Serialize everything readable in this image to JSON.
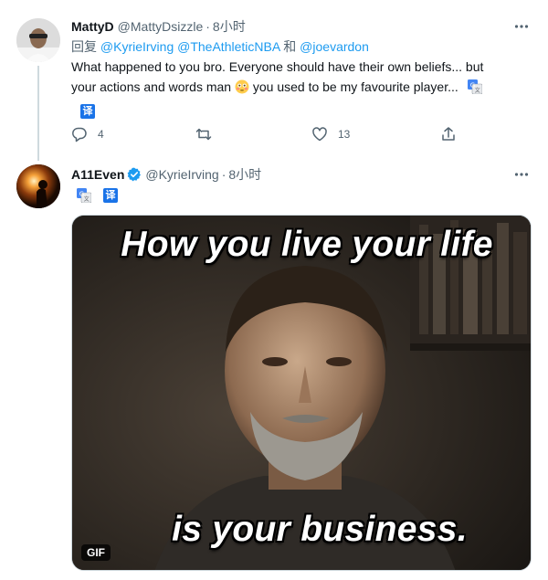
{
  "reply_tweet": {
    "display_name": "MattyD",
    "handle": "@MattyDsizzle",
    "separator": "·",
    "time": "8小时",
    "reply_prefix": "回复",
    "mentions": [
      "@KyrieIrving",
      "@TheAthleticNBA"
    ],
    "mention_joiner": "和",
    "last_mention": "@joevardon",
    "text_line1": "What happened to you bro. Everyone should have their own beliefs... but",
    "text_line2a": "your actions and words man",
    "emoji": "flushed-face",
    "text_line2b": "you used to be my favourite player...",
    "translate_badge": "译",
    "reply_count": "4",
    "retweet_count": "",
    "like_count": "13"
  },
  "main_tweet": {
    "display_name": "A11Even",
    "verified": true,
    "handle": "@KyrieIrving",
    "separator": "·",
    "time": "8小时",
    "translate_badge": "译",
    "media": {
      "type": "gif",
      "caption_top": "How you live your life",
      "caption_bottom": "is your business.",
      "badge": "GIF"
    }
  },
  "icons": {
    "more": "more-horizontal-icon",
    "reply": "reply-icon",
    "retweet": "retweet-icon",
    "like": "heart-icon",
    "share": "share-icon",
    "translate": "google-translate-icon",
    "verified": "verified-badge-icon"
  },
  "colors": {
    "link": "#1d9bf0",
    "secondary_text": "#536471",
    "primary_text": "#0f1419",
    "thread_line": "#cfd9de",
    "translate_blue": "#1a73e8"
  }
}
